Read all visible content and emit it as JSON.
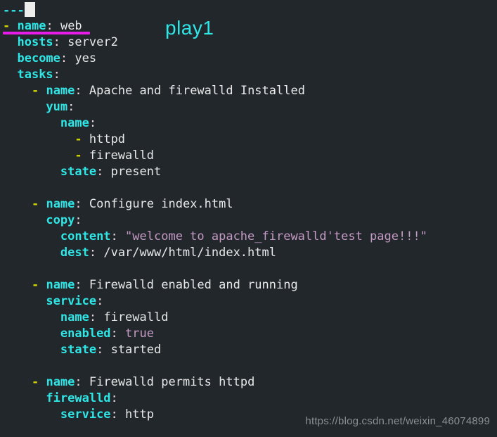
{
  "editor": {
    "background_color": "#22272b",
    "cursor_color": "#ededeb",
    "annotation": {
      "label": "play1",
      "color": "#2ee6e6"
    },
    "underline": {
      "color": "#e81ce8"
    },
    "watermark": "https://blog.csdn.net/weixin_46074899",
    "colors": {
      "key": "#2ee6e6",
      "dash": "#d4d400",
      "string": "#c49ac4",
      "plain": "#e8e8e8",
      "colon": "#f0d8e0"
    },
    "lines": [
      {
        "type": "doc_start",
        "indent": 0,
        "marker": "---",
        "cursor": true
      },
      {
        "type": "item",
        "indent": 0,
        "dash": "-",
        "key": "name",
        "colon": ":",
        "value": "web"
      },
      {
        "type": "pair",
        "indent": 2,
        "key": "hosts",
        "colon": ":",
        "value": "server2"
      },
      {
        "type": "pair",
        "indent": 2,
        "key": "become",
        "colon": ":",
        "value": "yes"
      },
      {
        "type": "pair",
        "indent": 2,
        "key": "tasks",
        "colon": ":",
        "value": ""
      },
      {
        "type": "item",
        "indent": 4,
        "dash": "-",
        "key": "name",
        "colon": ":",
        "value": "Apache and firewalld Installed"
      },
      {
        "type": "pair",
        "indent": 6,
        "key": "yum",
        "colon": ":",
        "value": ""
      },
      {
        "type": "pair",
        "indent": 8,
        "key": "name",
        "colon": ":",
        "value": ""
      },
      {
        "type": "listitem",
        "indent": 10,
        "dash": "-",
        "value": "httpd"
      },
      {
        "type": "listitem",
        "indent": 10,
        "dash": "-",
        "value": "firewalld"
      },
      {
        "type": "pair",
        "indent": 8,
        "key": "state",
        "colon": ":",
        "value": "present"
      },
      {
        "type": "blank"
      },
      {
        "type": "item",
        "indent": 4,
        "dash": "-",
        "key": "name",
        "colon": ":",
        "value": "Configure index.html"
      },
      {
        "type": "pair",
        "indent": 6,
        "key": "copy",
        "colon": ":",
        "value": ""
      },
      {
        "type": "pair",
        "indent": 8,
        "key": "content",
        "colon": ":",
        "value": "\"welcome to apache_firewalld'test page!!!\"",
        "value_kind": "string"
      },
      {
        "type": "pair",
        "indent": 8,
        "key": "dest",
        "colon": ":",
        "value": "/var/www/html/index.html"
      },
      {
        "type": "blank"
      },
      {
        "type": "item",
        "indent": 4,
        "dash": "-",
        "key": "name",
        "colon": ":",
        "value": "Firewalld enabled and running"
      },
      {
        "type": "pair",
        "indent": 6,
        "key": "service",
        "colon": ":",
        "value": ""
      },
      {
        "type": "pair",
        "indent": 8,
        "key": "name",
        "colon": ":",
        "value": "firewalld"
      },
      {
        "type": "pair",
        "indent": 8,
        "key": "enabled",
        "colon": ":",
        "value": "true",
        "value_kind": "bool"
      },
      {
        "type": "pair",
        "indent": 8,
        "key": "state",
        "colon": ":",
        "value": "started"
      },
      {
        "type": "blank"
      },
      {
        "type": "item",
        "indent": 4,
        "dash": "-",
        "key": "name",
        "colon": ":",
        "value": "Firewalld permits httpd"
      },
      {
        "type": "pair",
        "indent": 6,
        "key": "firewalld",
        "colon": ":",
        "value": ""
      },
      {
        "type": "pair",
        "indent": 8,
        "key": "service",
        "colon": ":",
        "value": "http"
      }
    ]
  }
}
